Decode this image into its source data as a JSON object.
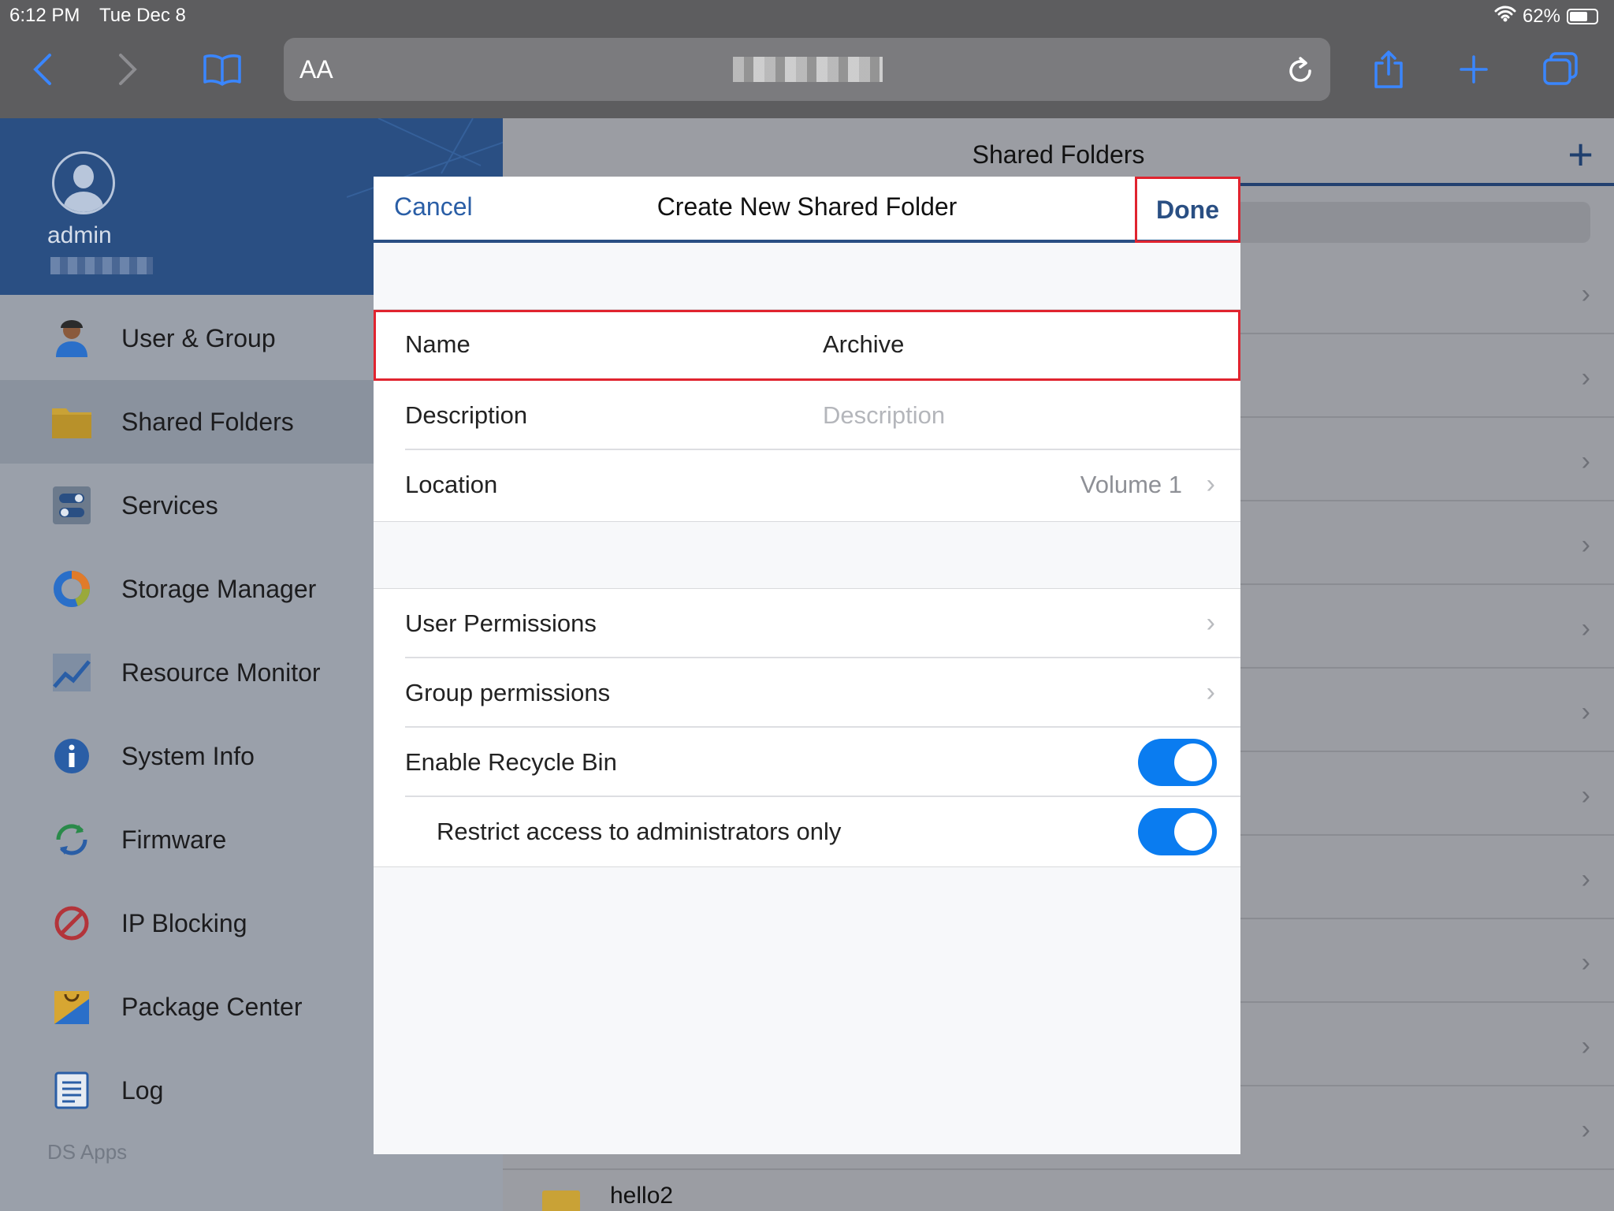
{
  "status": {
    "time": "6:12 PM",
    "date": "Tue Dec 8",
    "battery": "62%"
  },
  "browser": {
    "text_size_label": "AA"
  },
  "sidebar": {
    "user": "admin",
    "items": [
      {
        "label": "User & Group",
        "icon": "user-icon"
      },
      {
        "label": "Shared Folders",
        "icon": "folder-icon"
      },
      {
        "label": "Services",
        "icon": "toggles-icon"
      },
      {
        "label": "Storage Manager",
        "icon": "pie-icon"
      },
      {
        "label": "Resource Monitor",
        "icon": "line-chart-icon"
      },
      {
        "label": "System Info",
        "icon": "info-icon"
      },
      {
        "label": "Firmware",
        "icon": "refresh-icon"
      },
      {
        "label": "IP Blocking",
        "icon": "block-icon"
      },
      {
        "label": "Package Center",
        "icon": "package-icon"
      },
      {
        "label": "Log",
        "icon": "log-icon"
      }
    ],
    "section_label": "DS Apps"
  },
  "main": {
    "title": "Shared Folders",
    "visible_item": "hello2"
  },
  "modal": {
    "cancel_label": "Cancel",
    "title": "Create New Shared Folder",
    "done_label": "Done",
    "name_label": "Name",
    "name_value": "Archive",
    "description_label": "Description",
    "description_placeholder": "Description",
    "location_label": "Location",
    "location_value": "Volume 1",
    "user_permissions_label": "User Permissions",
    "group_permissions_label": "Group permissions",
    "recycle_bin_label": "Enable Recycle Bin",
    "recycle_bin_enabled": true,
    "restrict_label": "Restrict access to administrators only",
    "restrict_enabled": true
  },
  "colors": {
    "accent": "#2a4f83",
    "highlight": "#e0242f",
    "toggle_on": "#0a7cf0"
  }
}
